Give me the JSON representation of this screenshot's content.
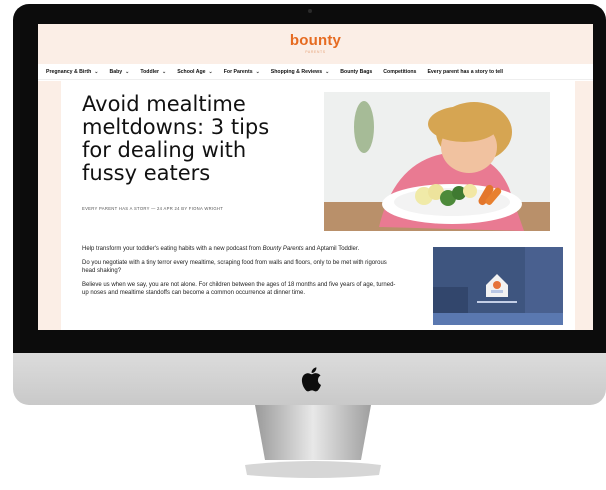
{
  "site": {
    "logo": "bounty",
    "logo_sub": "PARENTS"
  },
  "nav": [
    {
      "label": "Pregnancy & Birth",
      "dropdown": true
    },
    {
      "label": "Baby",
      "dropdown": true
    },
    {
      "label": "Toddler",
      "dropdown": true
    },
    {
      "label": "School Age",
      "dropdown": true
    },
    {
      "label": "For Parents",
      "dropdown": true
    },
    {
      "label": "Shopping & Reviews",
      "dropdown": true
    },
    {
      "label": "Bounty Bags",
      "dropdown": false
    },
    {
      "label": "Competitions",
      "dropdown": false
    },
    {
      "label": "Every parent has a story to tell",
      "dropdown": false
    }
  ],
  "article": {
    "title": "Avoid mealtime meltdowns: 3 tips for dealing with fussy eaters",
    "meta": "EVERY PARENT HAS A STORY — 24 APR 24 BY FIONA WRIGHT",
    "p1_a": "Help transform your toddler's eating habits with a new podcast from ",
    "p1_em": "Bounty Parents",
    "p1_b": " and Aptamil Toddler.",
    "p2": "Do you negotiate with a tiny terror every mealtime, scraping food from walls and floors, only to be met with rigorous head shaking?",
    "p3": "Believe us when we say, you are not alone. For children between the ages of 18 months and five years of age, turned-up noses and mealtime standoffs can become a common occurrence at dinner time."
  },
  "icons": {
    "chevron": "chevron-down-icon",
    "apple": "apple-logo-icon",
    "play": "play-icon"
  },
  "colors": {
    "brand": "#e66b21",
    "header_bg": "#fbeee6",
    "video_bg": "#3a4f78"
  }
}
